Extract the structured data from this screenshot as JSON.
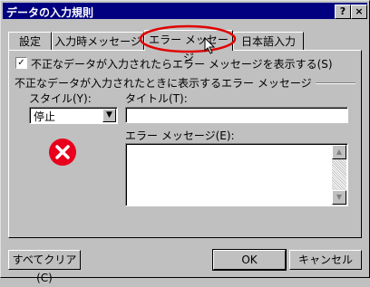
{
  "window": {
    "title": "データの入力規則",
    "help_label": "?",
    "close_label": "×"
  },
  "tabs": [
    {
      "label": "設定"
    },
    {
      "label": "入力時メッセージ"
    },
    {
      "label": "エラー メッセージ",
      "active": true
    },
    {
      "label": "日本語入力"
    }
  ],
  "panel": {
    "show_error_checkbox_label": "不正なデータが入力されたらエラー メッセージを表示する(S)",
    "show_error_checked": true,
    "group_label": "不正なデータが入力されたときに表示するエラー メッセージ",
    "style_label": "スタイル(Y):",
    "style_value": "停止",
    "title_label": "タイトル(T):",
    "title_value": "",
    "message_label": "エラー メッセージ(E):",
    "message_value": "",
    "error_icon": "error-stop-icon"
  },
  "footer": {
    "clear_all_label": "すべてクリア(C)",
    "ok_label": "OK",
    "cancel_label": "キャンセル"
  },
  "colors": {
    "titlebar": "#000080",
    "error_icon": "#e8001c",
    "highlight_ellipse": "#e00000"
  }
}
